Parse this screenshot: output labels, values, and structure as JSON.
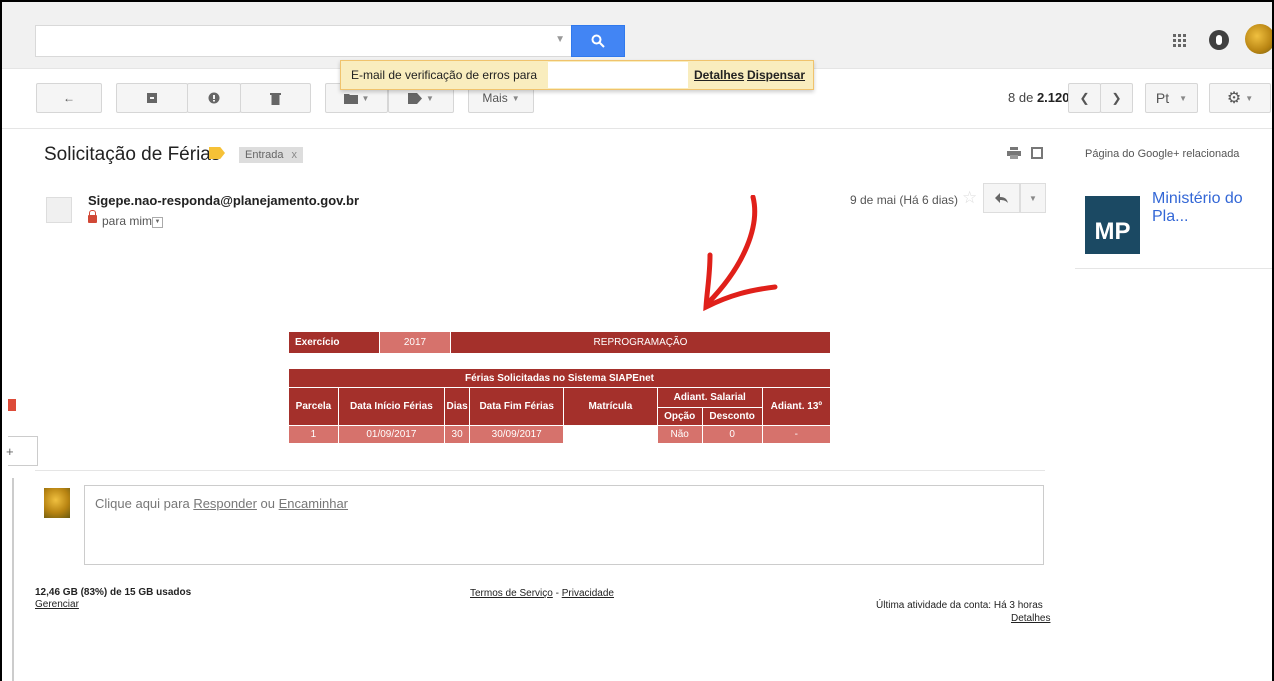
{
  "search": {
    "placeholder": "",
    "value": ""
  },
  "tooltip": {
    "message": "E-mail de verificação de erros para",
    "details_link": "Detalhes",
    "dismiss_link": "Dispensar"
  },
  "toolbar": {
    "more_label": "Mais",
    "counter_position": "8 de",
    "counter_total": "2.120",
    "lang_label": "Pt"
  },
  "email": {
    "subject": "Solicitação de Férias",
    "label": "Entrada",
    "label_remove": "x",
    "sender": "Sigepe.nao-responda@planejamento.gov.br",
    "recipient": "para mim",
    "date": "9 de mai (Há 6 dias)"
  },
  "sidebar": {
    "gplus_label": "Página do Google+ relacionada",
    "logo_text": "MP",
    "org_name": "Ministério do Pla..."
  },
  "table1": {
    "c1": "Exercício",
    "c2": "2017",
    "c3": "REPROGRAMAÇÃO"
  },
  "table2": {
    "title": "Férias Solicitadas no Sistema SIAPEnet",
    "headers": {
      "parcela": "Parcela",
      "inicio": "Data Início Férias",
      "dias": "Dias",
      "fim": "Data Fim Férias",
      "matricula": "Matrícula",
      "adiant_salarial": "Adiant. Salarial",
      "opcao": "Opção",
      "desconto": "Desconto",
      "adiant13": "Adiant. 13º"
    },
    "row": {
      "parcela": "1",
      "inicio": "01/09/2017",
      "dias": "30",
      "fim": "30/09/2017",
      "matricula": "",
      "opcao": "Não",
      "desconto": "0",
      "adiant13": "-"
    }
  },
  "reply": {
    "prefix": "Clique aqui para",
    "reply_link": "Responder",
    "or": "ou",
    "forward_link": "Encaminhar"
  },
  "footer": {
    "storage": "12,46 GB (83%) de 15 GB usados",
    "manage": "Gerenciar",
    "terms": "Termos de Serviço",
    "sep": "-",
    "privacy": "Privacidade",
    "activity": "Última atividade da conta: Há 3 horas",
    "details": "Detalhes"
  },
  "colors": {
    "search_blue": "#4285f4",
    "table_header": "#a4302b",
    "table_cell": "#d6726c",
    "annotation_red": "#e0201a",
    "mp_blue": "#1b4963"
  }
}
